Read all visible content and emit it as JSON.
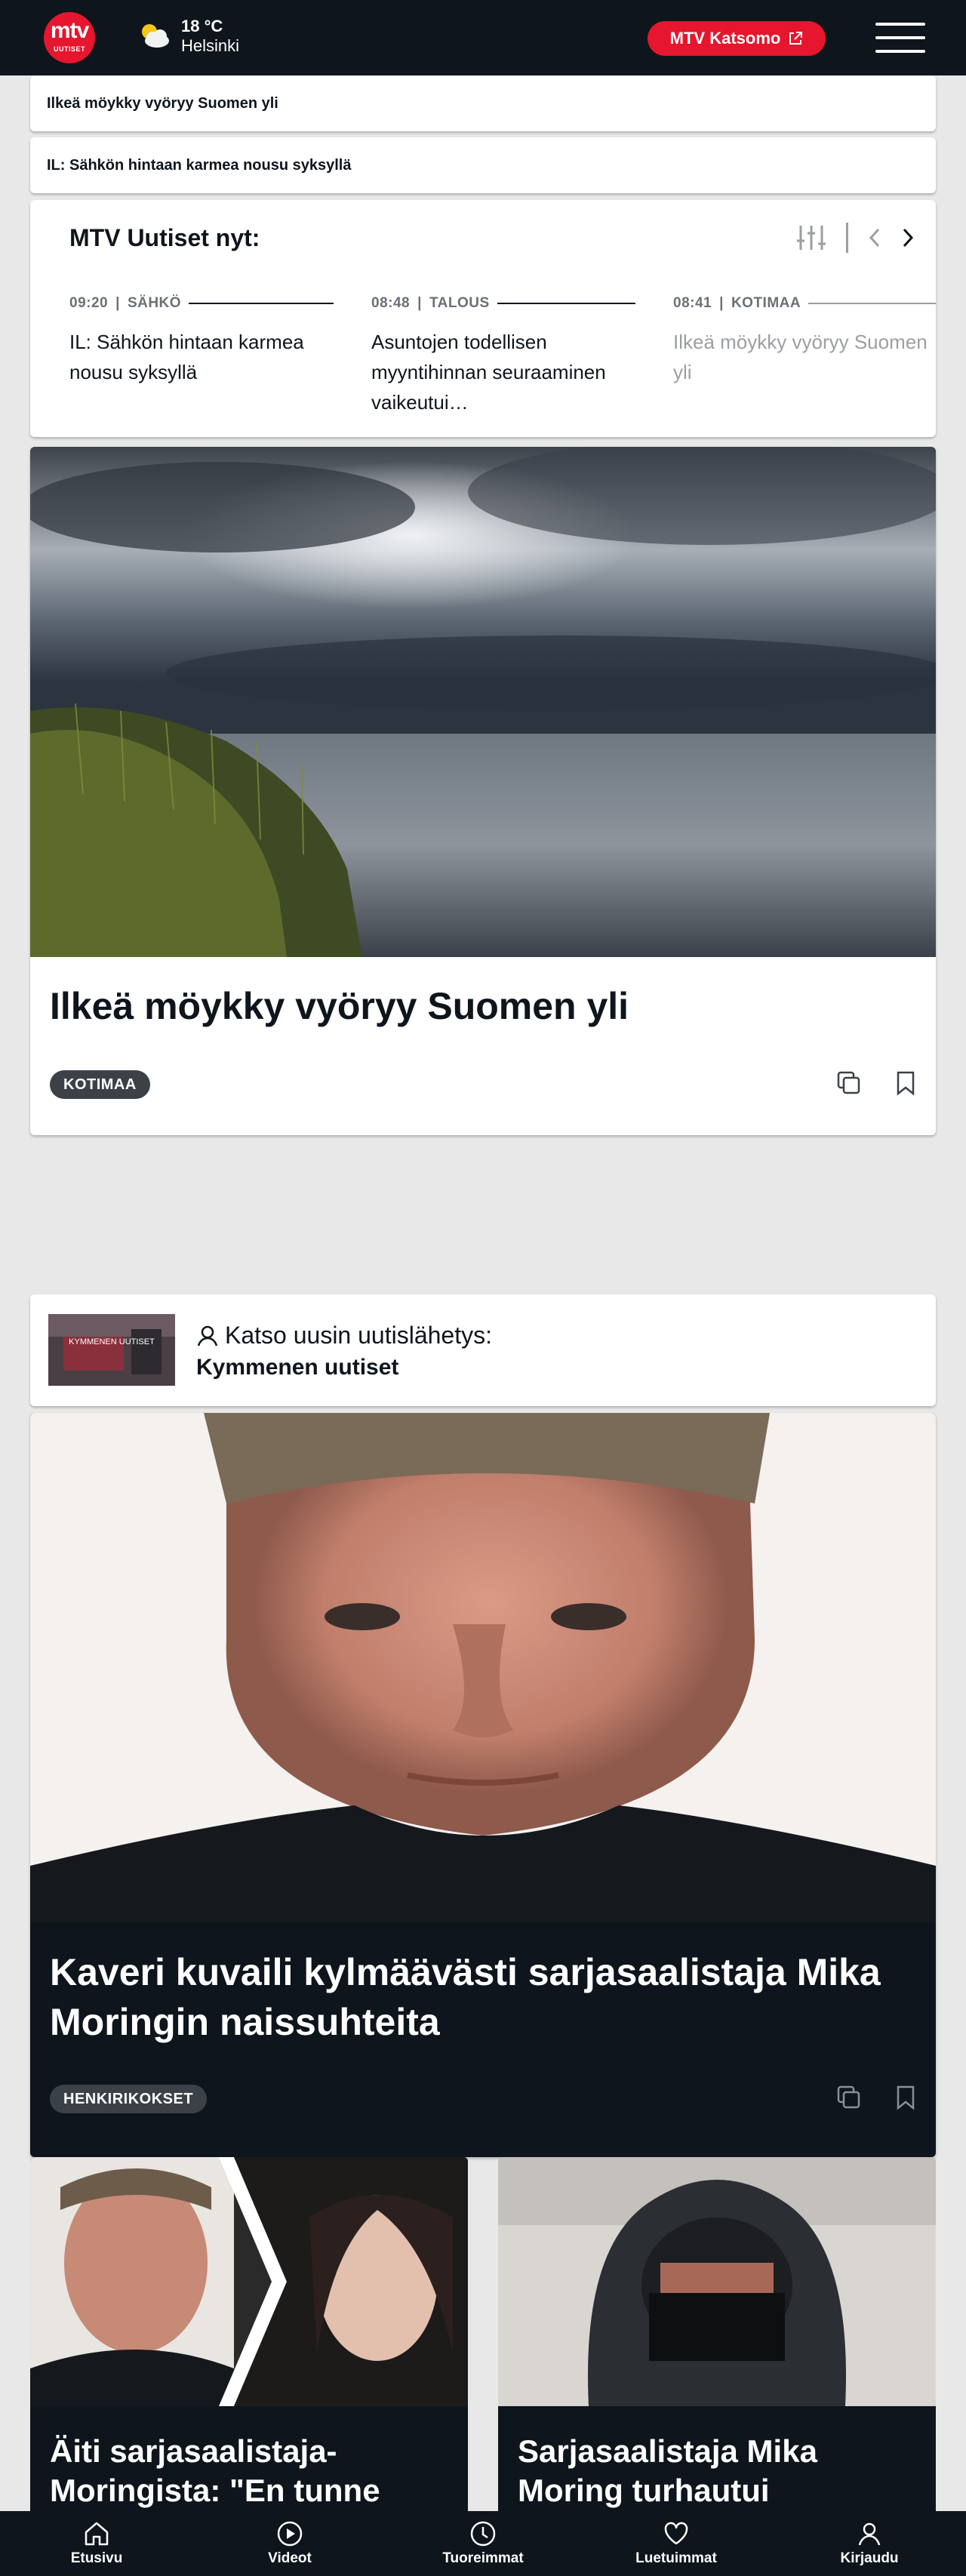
{
  "header": {
    "logo_text": "mtv",
    "logo_sub": "UUTISET",
    "weather_icon": "partly-cloudy-icon",
    "temperature": "18 °C",
    "city": "Helsinki",
    "katsomo_label": "MTV Katsomo",
    "colors": {
      "bar": "#0e151c",
      "accent": "#e5162e"
    }
  },
  "breaking": [
    {
      "text": "Ilkeä möykky vyöryy Suomen yli"
    },
    {
      "text": "IL: Sähkön hintaan karmea nousu syksyllä"
    }
  ],
  "news_now": {
    "title": "MTV Uutiset nyt:",
    "items": [
      {
        "time": "09:20",
        "category": "SÄHKÖ",
        "headline": "IL: Sähkön hintaan karmea nousu syksyllä"
      },
      {
        "time": "08:48",
        "category": "TALOUS",
        "headline": "Asuntojen todellisen myyntihinnan seuraaminen vaikeutui…"
      },
      {
        "time": "08:41",
        "category": "KOTIMAA",
        "headline": "Ilkeä möykky vyöryy Suomen yli"
      }
    ]
  },
  "feature": {
    "title": "Ilkeä möykky vyöryy Suomen yli",
    "tag": "KOTIMAA"
  },
  "katso": {
    "label": "Katso uusin uutislähetys:",
    "program": "Kymmenen uutiset",
    "thumb_text": "KYMMENEN UUTISET"
  },
  "feature2": {
    "title": "Kaveri kuvaili kylmäävästi sarjasaalistaja Mika Moringin naissuhteita",
    "tag": "HENKIRIKOKSET"
  },
  "small_cards": [
    {
      "title": "Äiti sarjasaalistaja-Moringista: \"En tunne omaa"
    },
    {
      "title": "Sarjasaalistaja Mika Moring turhautui kysymyksiin"
    }
  ],
  "bottom_nav": [
    {
      "label": "Etusivu",
      "icon": "home-icon"
    },
    {
      "label": "Videot",
      "icon": "play-icon"
    },
    {
      "label": "Tuoreimmat",
      "icon": "clock-icon"
    },
    {
      "label": "Luetuimmat",
      "icon": "heart-icon"
    },
    {
      "label": "Kirjaudu",
      "icon": "user-icon"
    }
  ]
}
